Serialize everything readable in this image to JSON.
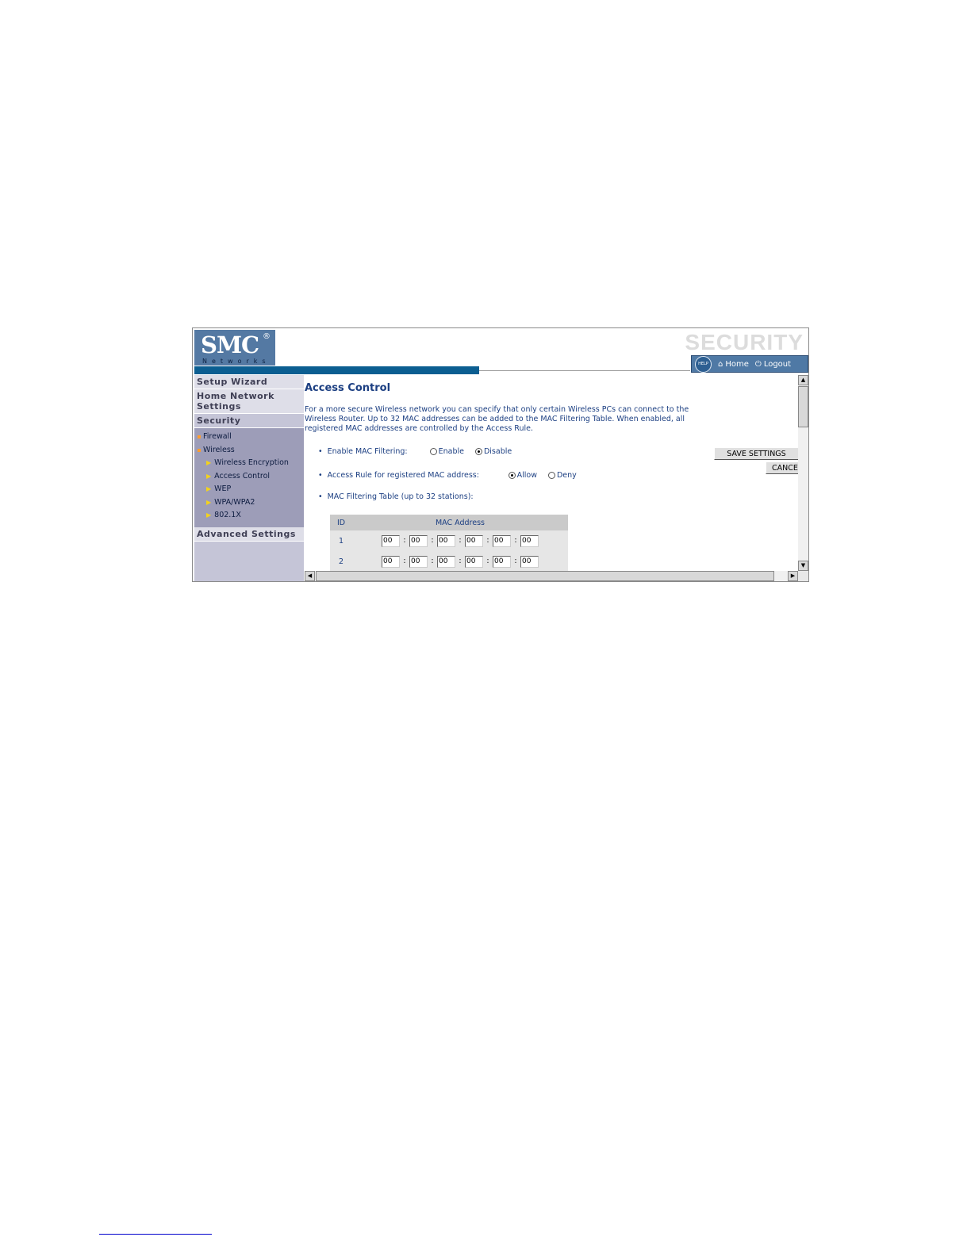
{
  "logo": {
    "brand": "SMC",
    "registered": "®",
    "subtitle": "Networks"
  },
  "section_title": "SECURITY",
  "toolbar": {
    "help": "HELP",
    "home": "Home",
    "logout": "Logout",
    "home_icon": "home-icon",
    "logout_icon": "power-icon"
  },
  "sidebar": {
    "setup_wizard": "Setup Wizard",
    "home_network": "Home Network Settings",
    "security": "Security",
    "firewall": "Firewall",
    "wireless": "Wireless",
    "children": [
      "Wireless Encryption",
      "Access Control",
      "WEP",
      "WPA/WPA2",
      "802.1X"
    ],
    "advanced": "Advanced Settings"
  },
  "content": {
    "title": "Access Control",
    "intro": "For a more secure Wireless network you can specify that only certain Wireless PCs can connect to the Wireless Router. Up to 32 MAC addresses can be added to the MAC Filtering Table. When enabled, all registered MAC addresses are controlled by the Access Rule.",
    "mac_filtering": {
      "label": "Enable MAC Filtering:",
      "enable": "Enable",
      "disable": "Disable",
      "selected": "Disable"
    },
    "access_rule": {
      "label": "Access Rule for registered MAC address:",
      "allow": "Allow",
      "deny": "Deny",
      "selected": "Allow"
    },
    "table_label": "MAC Filtering Table (up to 32 stations):",
    "table": {
      "headers": [
        "ID",
        "MAC Address"
      ],
      "rows": [
        {
          "id": "1",
          "octets": [
            "00",
            "00",
            "00",
            "00",
            "00",
            "00"
          ]
        },
        {
          "id": "2",
          "octets": [
            "00",
            "00",
            "00",
            "00",
            "00",
            "00"
          ]
        }
      ]
    },
    "save_button": "SAVE SETTINGS",
    "cancel_button": "CANCE"
  },
  "colors": {
    "brand_blue": "#0b5e91",
    "sidebar": "#c5c5d7",
    "text_blue": "#1c3f82"
  }
}
